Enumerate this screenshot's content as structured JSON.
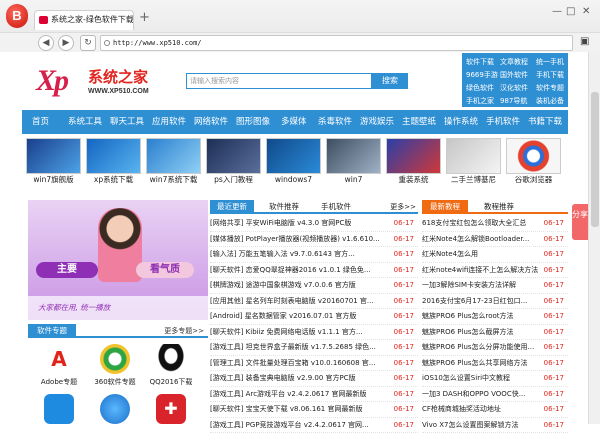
{
  "browser": {
    "menu_logo": "B",
    "tab_title": "系统之家-绿色软件下载",
    "new_tab": "+",
    "window_min": "—",
    "window_max": "□",
    "window_close": "✕",
    "back": "◀",
    "forward": "▶",
    "address": "http://www.xp510.com/"
  },
  "site": {
    "logo_xp": "Xp",
    "logo_cn": "系统之家",
    "logo_url": "WWW.XP510.COM",
    "search_placeholder": "请输入搜索内容",
    "search_button": "搜索",
    "quick_links": [
      "软件下载",
      "文章教程",
      "统一手机",
      "9669手游",
      "国外软件",
      "手机下载",
      "绿色软件",
      "汉化软件",
      "软件专题",
      "手机之家",
      "987导航",
      "装机必备"
    ],
    "nav": [
      "首页",
      "系统工具",
      "聊天工具",
      "应用软件",
      "网络软件",
      "图形图像",
      "多媒体",
      "杀毒软件",
      "游戏娱乐",
      "主题壁纸",
      "操作系统",
      "手机软件",
      "书籍下载"
    ],
    "thumbs": [
      "win7旗舰版",
      "xp系统下载",
      "win7系统下载",
      "ps入门教程",
      "windows7",
      "win7",
      "重装系统",
      "二手兰博基尼",
      "谷歌浏览器"
    ],
    "banner": {
      "left": "主要",
      "right": "看气质",
      "strip": "大家都在用, 统一播放"
    },
    "special": {
      "title": "软件专题",
      "more": "更多专题>>"
    },
    "apps": [
      "Adobe专题",
      "360软件专题",
      "QQ2016下载"
    ],
    "latest": {
      "tab1": "最近更新",
      "tab2": "软件推荐",
      "tab3": "手机软件",
      "more": "更多>>"
    },
    "latest_rows": [
      {
        "t": "[网络共享] 平安WiFi电脑版 v4.3.0 官网PC版",
        "d": "06-17"
      },
      {
        "t": "[媒体播放] PotPlayer播放器(视频播放器) v1.6.610...",
        "d": "06-17"
      },
      {
        "t": "[输入法] 万能五笔输入法 v9.7.0.6143 官方...",
        "d": "06-17"
      },
      {
        "t": "[聊天软件] 恋爱QQ翠捉神器2016 v1.0.1 绿色免...",
        "d": "06-17"
      },
      {
        "t": "[棋牌游戏] 途游中国象棋游戏 v7.0.0.6 官方版",
        "d": "06-17"
      },
      {
        "t": "[应用其他] 星名列车时刻表电脑版 v20160701 官...",
        "d": "06-17"
      },
      {
        "t": "[Android] 星名数据管家 v2016.07.01 官方版",
        "d": "06-17"
      },
      {
        "t": "[聊天软件] Kibiiz 免费网络电话版 v1.1.1 官方...",
        "d": "06-17"
      },
      {
        "t": "[游戏工具] 坦克世界盒子最新版 v1.7.5.2685 绿色...",
        "d": "06-17"
      },
      {
        "t": "[管理工具] 文件批量处理百宝箱 v10.0.160608 官...",
        "d": "06-17"
      },
      {
        "t": "[游戏工具] 装备宝典电脑版 v2.9.00 官方PC版",
        "d": "06-17"
      },
      {
        "t": "[游戏工具] Arc游戏平台 v2.4.2.0617 官网最新版",
        "d": "06-17"
      },
      {
        "t": "[聊天软件] 宝宝天使下载 v8.06.161 官网最新版",
        "d": "06-17"
      },
      {
        "t": "[游戏工具] PGP竞技游戏平台 v2.4.2.0617 官网...",
        "d": "06-17"
      }
    ],
    "tutorial": {
      "tab1": "最新教程",
      "tab2": "教程推荐"
    },
    "tutorial_rows": [
      {
        "t": "618支付宝红包怎么领取大全汇总",
        "d": "06-17"
      },
      {
        "t": "红米Note4怎么解锁Bootloader...",
        "d": "06-17"
      },
      {
        "t": "红米Note4怎么用",
        "d": "06-17"
      },
      {
        "t": "红米note4wifi连接不上怎么解决方法",
        "d": "06-17"
      },
      {
        "t": "一加3解除SIM卡安装方法详解",
        "d": "06-17"
      },
      {
        "t": "2016支付宝6月17-23日红包口...",
        "d": "06-17"
      },
      {
        "t": "魅族PRO6 Plus怎么root方法",
        "d": "06-17"
      },
      {
        "t": "魅族PRO6 Plus怎么截屏方法",
        "d": "06-17"
      },
      {
        "t": "魅族PRO6 Plus怎么分屏功能使用...",
        "d": "06-17"
      },
      {
        "t": "魅族PRO6 Plus怎么共享网络方法",
        "d": "06-17"
      },
      {
        "t": "iOS10怎么设置Siri中文教程",
        "d": "06-17"
      },
      {
        "t": "一加3 DASH和OPPO VOOC快...",
        "d": "06-17"
      },
      {
        "t": "CF枪械商城抽奖活动地址",
        "d": "06-17"
      },
      {
        "t": "Vivo X7怎么设置图案解锁方法",
        "d": "06-17"
      }
    ],
    "share": "分享",
    "colors": {
      "brand": "#2f8fd3",
      "date": "#e0261c",
      "accent": "#f06a12"
    }
  }
}
